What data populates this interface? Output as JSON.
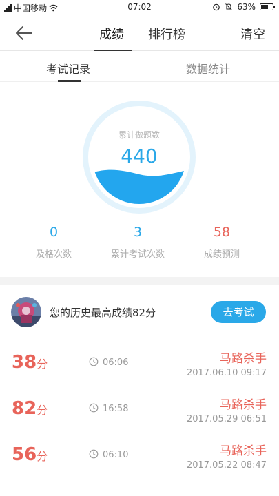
{
  "status_bar": {
    "carrier": "中国移动",
    "time": "07:02",
    "battery_percent": "63%",
    "battery_level": 0.63
  },
  "nav": {
    "tabs": [
      {
        "label": "成绩",
        "active": true
      },
      {
        "label": "排行榜",
        "active": false
      }
    ],
    "clear_label": "清空"
  },
  "sub_tabs": [
    {
      "label": "考试记录",
      "active": true
    },
    {
      "label": "数据统计",
      "active": false
    }
  ],
  "gauge": {
    "label": "累计做题数",
    "value": "440"
  },
  "stats": [
    {
      "value": "0",
      "label": "及格次数"
    },
    {
      "value": "3",
      "label": "累计考试次数"
    },
    {
      "value": "58",
      "label": "成绩预测"
    }
  ],
  "best": {
    "text": "您的历史最高成绩82分",
    "button_label": "去考试"
  },
  "records": [
    {
      "score": "38",
      "unit": "分",
      "duration": "06:06",
      "title": "马路杀手",
      "date": "2017.06.10  09:17"
    },
    {
      "score": "82",
      "unit": "分",
      "duration": "16:58",
      "title": "马路杀手",
      "date": "2017.05.29  06:51"
    },
    {
      "score": "56",
      "unit": "分",
      "duration": "06:10",
      "title": "马路杀手",
      "date": "2017.05.22  08:47"
    }
  ],
  "colors": {
    "accent": "#2aa8e8",
    "score_red": "#e8645a"
  }
}
